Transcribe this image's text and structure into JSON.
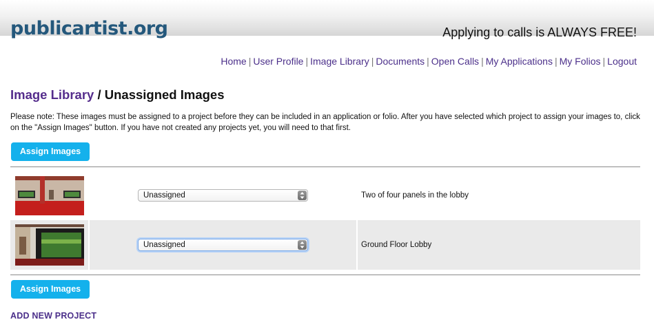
{
  "header": {
    "logo_text": "publicartist.org",
    "tagline": "Applying to calls is ALWAYS FREE!"
  },
  "nav": {
    "items": [
      "Home",
      "User Profile",
      "Image Library",
      "Documents",
      "Open Calls",
      "My Applications",
      "My Folios",
      "Logout"
    ],
    "separator": "|"
  },
  "title": {
    "crumb": "Image Library",
    "separator": " / ",
    "current": "Unassigned Images"
  },
  "note": "Please note: These images must be assigned to a project before they can be included in an application or folio. After you have selected which project to assign your images to, click on the \"Assign Images\" button. If you have not created any projects yet, you will need to that first.",
  "buttons": {
    "assign_top": "Assign Images",
    "assign_bottom": "Assign Images"
  },
  "images": [
    {
      "project": "Unassigned",
      "caption": "Two of four panels in the lobby"
    },
    {
      "project": "Unassigned",
      "caption": "Ground Floor Lobby"
    }
  ],
  "add_project": "ADD NEW PROJECT",
  "colors": {
    "logo": "#24587c",
    "link": "#4b2f8a",
    "title_crumb": "#552d8c",
    "button": "#14b1ec"
  }
}
